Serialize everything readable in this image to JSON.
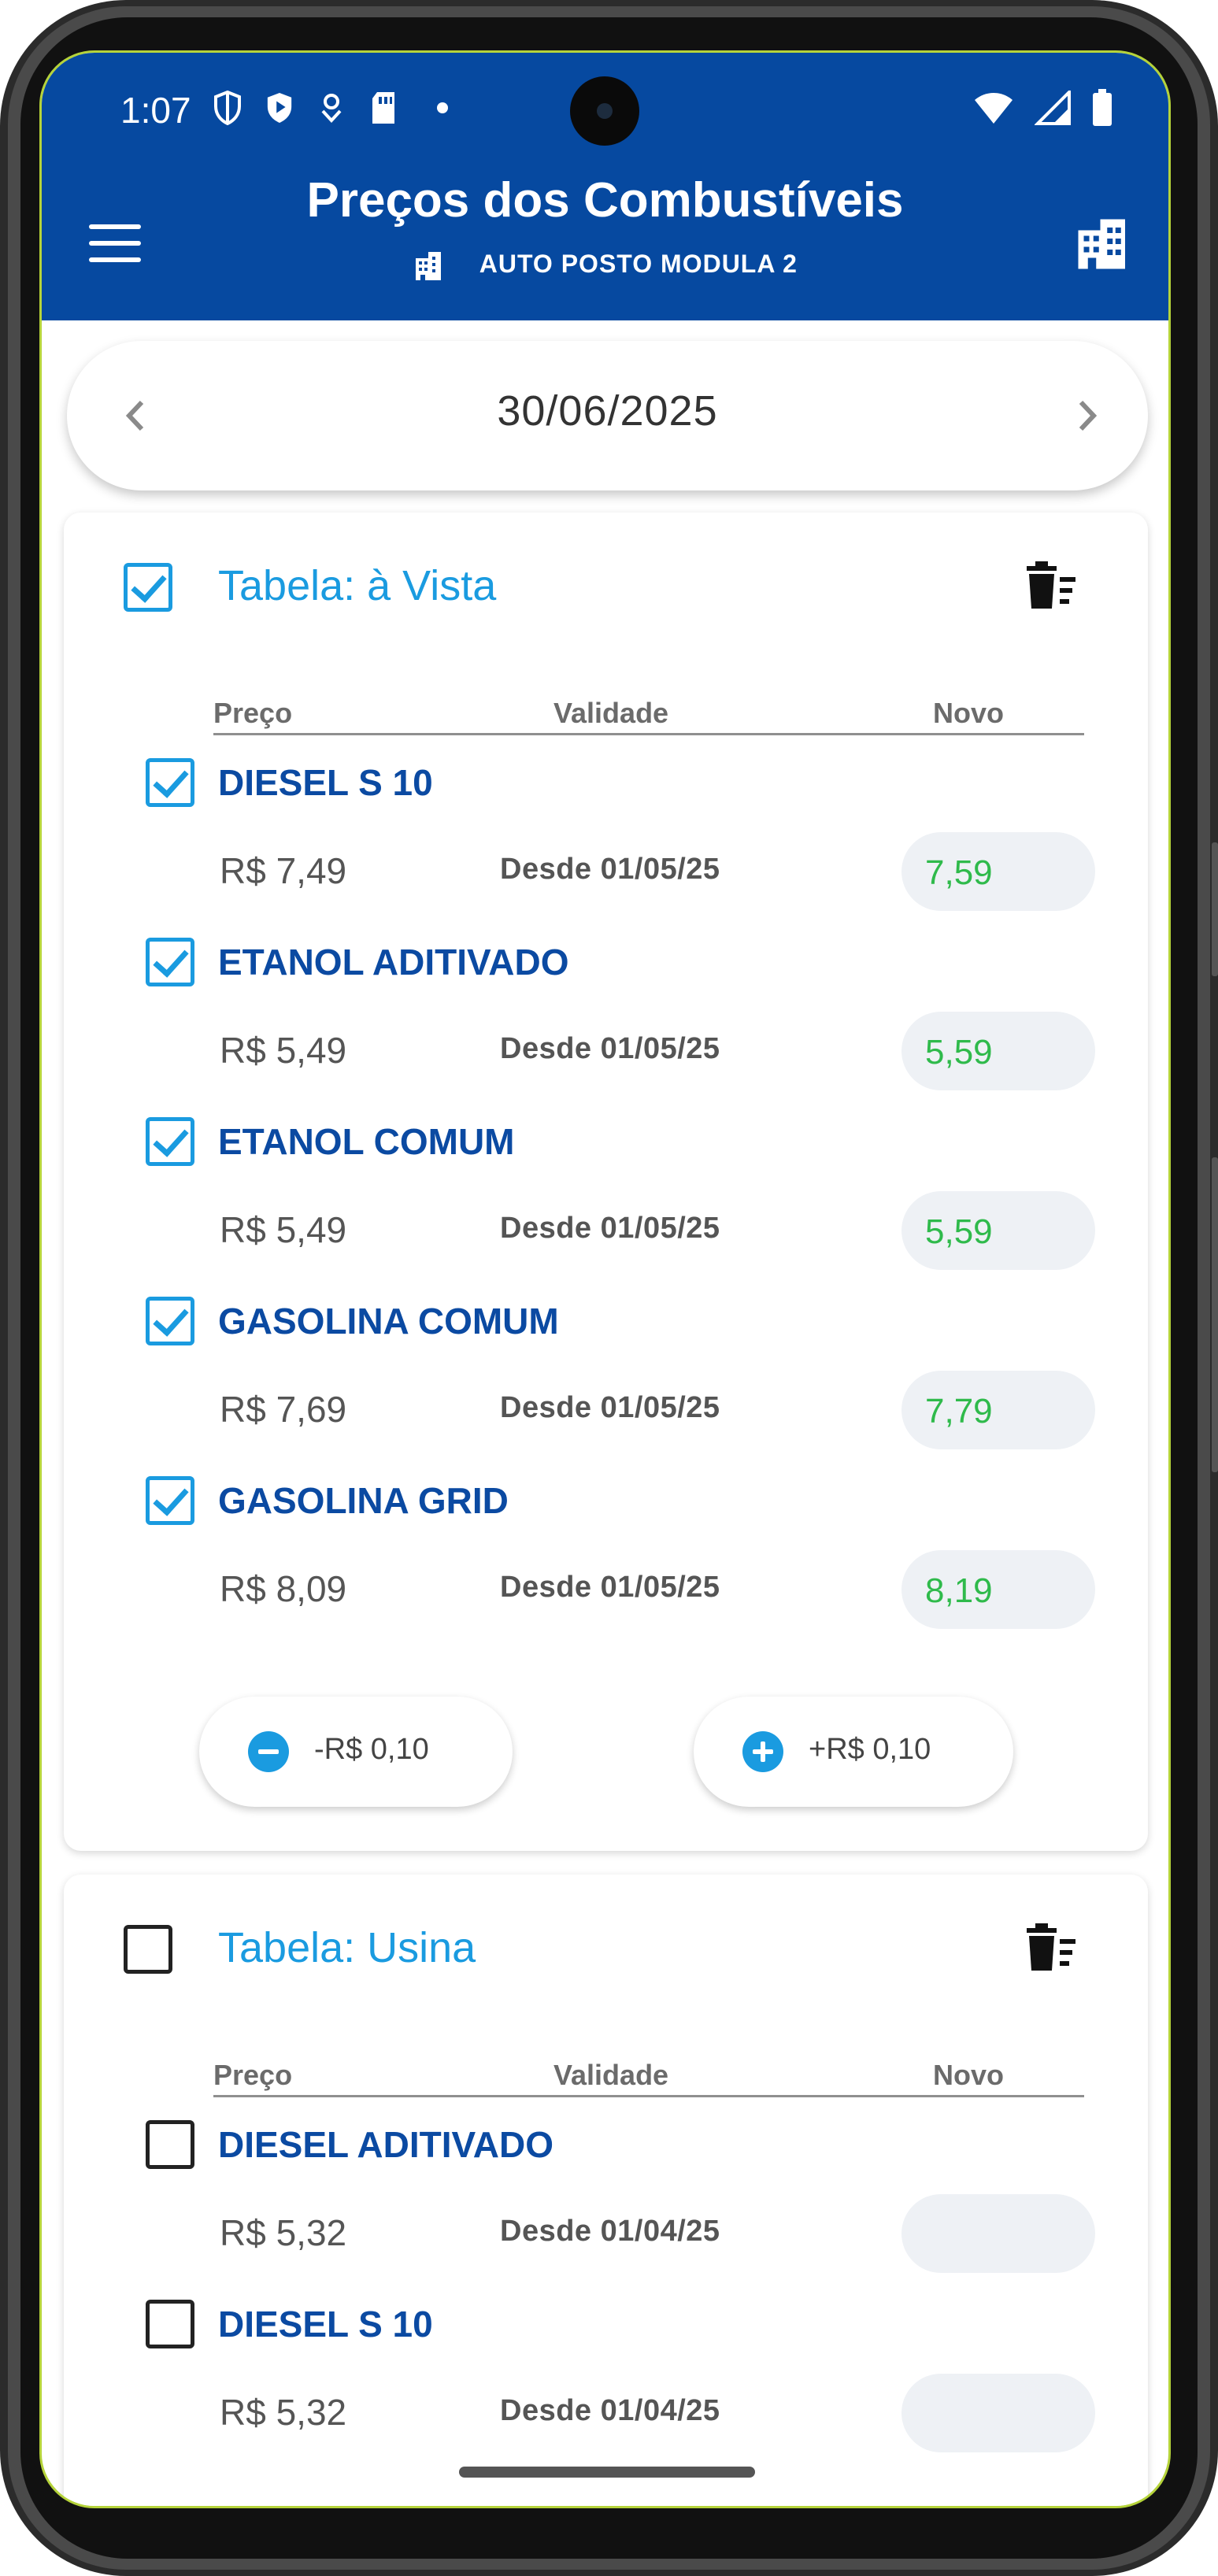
{
  "status_bar": {
    "time": "1:07",
    "left_icons": [
      "shield-outline-icon",
      "shield-play-icon",
      "location-icon",
      "sd-card-icon",
      "notification-dot"
    ],
    "right_icons": [
      "wifi-icon",
      "signal-icon",
      "battery-icon"
    ]
  },
  "header": {
    "title": "Preços dos Combustíveis",
    "subtitle": "AUTO POSTO MODULA 2",
    "background_color": "#0649a0"
  },
  "date_selector": {
    "date": "30/06/2025"
  },
  "columns": {
    "price": "Preço",
    "validity": "Validade",
    "new": "Novo"
  },
  "tables": [
    {
      "title": "Tabela: à Vista",
      "checked": true,
      "items": [
        {
          "name": "DIESEL S 10",
          "price": "R$ 7,49",
          "since": "Desde 01/05/25",
          "new": "7,59",
          "checked": true
        },
        {
          "name": "ETANOL ADITIVADO",
          "price": "R$ 5,49",
          "since": "Desde 01/05/25",
          "new": "5,59",
          "checked": true
        },
        {
          "name": "ETANOL COMUM",
          "price": "R$ 5,49",
          "since": "Desde 01/05/25",
          "new": "5,59",
          "checked": true
        },
        {
          "name": "GASOLINA COMUM",
          "price": "R$ 7,69",
          "since": "Desde 01/05/25",
          "new": "7,79",
          "checked": true
        },
        {
          "name": "GASOLINA GRID",
          "price": "R$ 8,09",
          "since": "Desde 01/05/25",
          "new": "8,19",
          "checked": true
        }
      ],
      "decrease_label": "-R$ 0,10",
      "increase_label": "+R$ 0,10"
    },
    {
      "title": "Tabela: Usina",
      "checked": false,
      "items": [
        {
          "name": "DIESEL ADITIVADO",
          "price": "R$ 5,32",
          "since": "Desde 01/04/25",
          "new": "",
          "checked": false
        },
        {
          "name": "DIESEL S 10",
          "price": "R$ 5,32",
          "since": "Desde 01/04/25",
          "new": "",
          "checked": false
        }
      ]
    }
  ],
  "colors": {
    "accent": "#1a9be0",
    "fuel_name": "#0b4aa2",
    "new_price": "#2fba4b"
  }
}
